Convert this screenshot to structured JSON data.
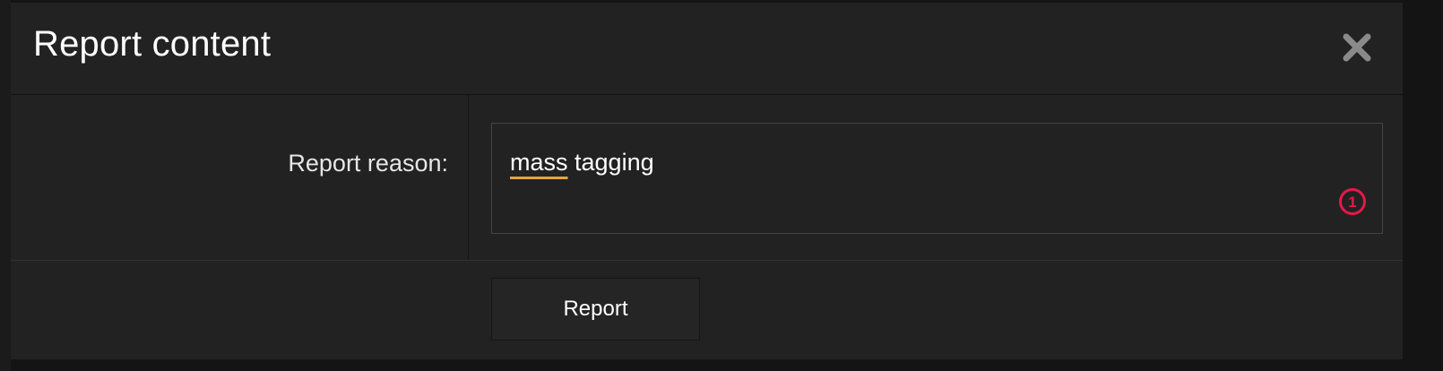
{
  "dialog": {
    "title": "Report content",
    "close_icon": "close-x-icon",
    "form": {
      "reason_label": "Report reason:",
      "reason_value": {
        "misspelled_word": "mass",
        "rest": " tagging"
      },
      "char_badge_count": "1"
    },
    "footer": {
      "report_label": "Report"
    }
  },
  "colors": {
    "background": "#222222",
    "text": "#ffffff",
    "spellcheck_underline": "#e8a33a",
    "badge": "#e8174a",
    "close_icon": "#8a8a8a"
  }
}
